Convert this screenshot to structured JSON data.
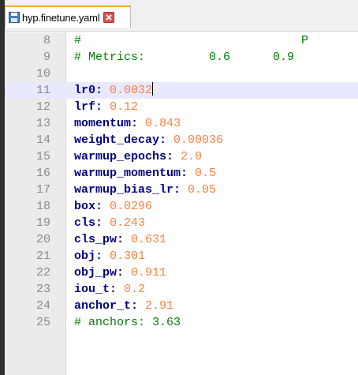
{
  "tab": {
    "title": "hyp.finetune.yaml",
    "icon": "save-icon",
    "close_icon": "close-icon"
  },
  "colors": {
    "comment": "#008000",
    "key": "#000080",
    "value": "#ff8040",
    "line_number": "#8a8a8a",
    "current_line": "#e8e8ff",
    "gutter": "#ebebeb",
    "tab_accent": "#f5a623"
  },
  "editor": {
    "lines": [
      {
        "num": "8",
        "comment": "#                               P"
      },
      {
        "num": "9",
        "comment": "# Metrics:         0.6      0.9"
      },
      {
        "num": "10"
      },
      {
        "num": "11",
        "key": "lr0",
        "value": "0.0032",
        "current": true
      },
      {
        "num": "12",
        "key": "lrf",
        "value": "0.12"
      },
      {
        "num": "13",
        "key": "momentum",
        "value": "0.843"
      },
      {
        "num": "14",
        "key": "weight_decay",
        "value": "0.00036"
      },
      {
        "num": "15",
        "key": "warmup_epochs",
        "value": "2.0"
      },
      {
        "num": "16",
        "key": "warmup_momentum",
        "value": "0.5"
      },
      {
        "num": "17",
        "key": "warmup_bias_lr",
        "value": "0.05"
      },
      {
        "num": "18",
        "key": "box",
        "value": "0.0296"
      },
      {
        "num": "19",
        "key": "cls",
        "value": "0.243"
      },
      {
        "num": "20",
        "key": "cls_pw",
        "value": "0.631"
      },
      {
        "num": "21",
        "key": "obj",
        "value": "0.301"
      },
      {
        "num": "22",
        "key": "obj_pw",
        "value": "0.911"
      },
      {
        "num": "23",
        "key": "iou_t",
        "value": "0.2"
      },
      {
        "num": "24",
        "key": "anchor_t",
        "value": "2.91"
      },
      {
        "num": "25",
        "comment": "# anchors: 3.63"
      }
    ]
  }
}
